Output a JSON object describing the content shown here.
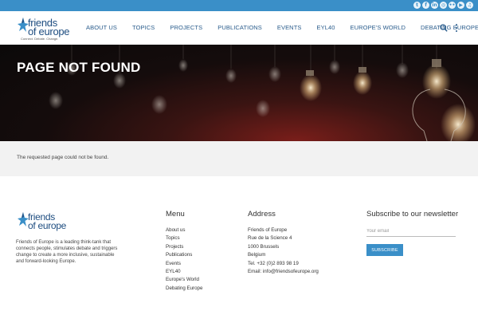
{
  "social": {
    "icons": [
      "twitter-icon",
      "facebook-icon",
      "linkedin-icon",
      "instagram-icon",
      "flickr-icon",
      "youtube-icon",
      "podcast-icon"
    ],
    "glyphs": [
      "t",
      "f",
      "in",
      "◎",
      "••",
      "▶",
      "♫"
    ]
  },
  "brand": {
    "line1": "friends",
    "line2": "of europe",
    "tagline": "Connect. Debate. Change."
  },
  "nav": {
    "items": [
      "ABOUT US",
      "TOPICS",
      "PROJECTS",
      "PUBLICATIONS",
      "EVENTS",
      "EYL40",
      "EUROPE'S WORLD",
      "DEBATING EUROPE"
    ]
  },
  "hero": {
    "title": "PAGE NOT FOUND"
  },
  "notice": {
    "message": "The requested page could not be found."
  },
  "footer": {
    "about": "Friends of Europe is a leading think-tank that connects people, stimulates debate and triggers change to create a more inclusive, sustainable and forward-looking Europe.",
    "menu_title": "Menu",
    "menu_items": [
      "About us",
      "Topics",
      "Projects",
      "Publications",
      "Events",
      "EYL40",
      "Europe's World",
      "Debating Europe"
    ],
    "address_title": "Address",
    "address_lines": [
      "Friends of Europe",
      "Rue de la Science 4",
      "1000 Brussels",
      "Belgium",
      "Tel. +32 (0)2 893 98 19",
      "Email: info@friendsofeurope.org"
    ],
    "newsletter_title": "Subscribe to our newsletter",
    "email_placeholder": "Your email",
    "subscribe_label": "SUBSCRIBE"
  },
  "colors": {
    "brand_blue": "#3a8fc8",
    "nav_text": "#2a5c8c",
    "logo_text": "#1e4d80"
  }
}
